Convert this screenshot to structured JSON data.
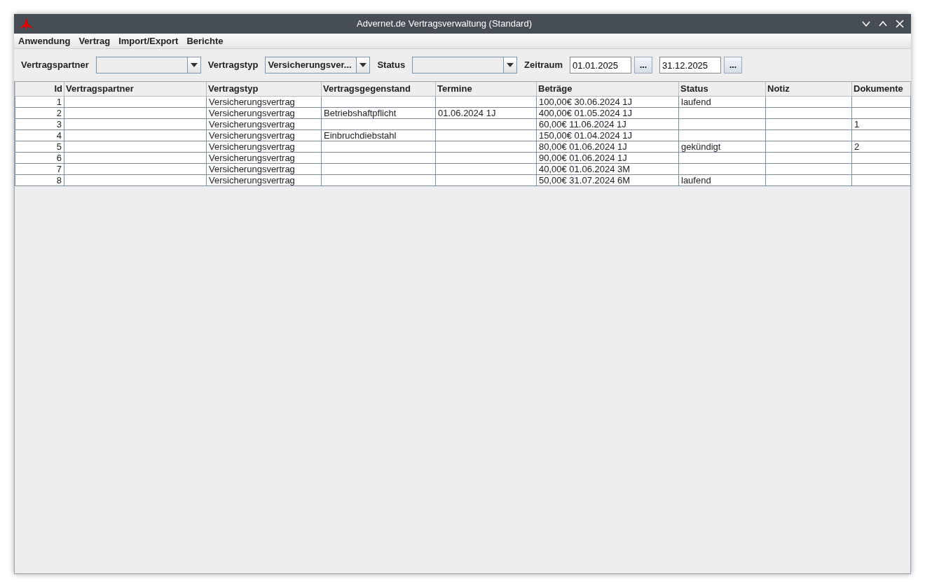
{
  "window": {
    "title": "Advernet.de Vertragsverwaltung (Standard)"
  },
  "menu": [
    "Anwendung",
    "Vertrag",
    "Import/Export",
    "Berichte"
  ],
  "filters": [
    {
      "kind": "combo",
      "label": "Vertragspartner"
    },
    {
      "kind": "combo",
      "label": "Vertragstyp",
      "value": "Versicherungsver..."
    },
    {
      "kind": "combo",
      "label": "Status"
    },
    {
      "kind": "dates",
      "label": "Zeitraum",
      "from": "01.01.2025",
      "to": "31.12.2025",
      "button": "..."
    }
  ],
  "table": {
    "columns": [
      "Id",
      "Vertragspartner",
      "Vertragstyp",
      "Vertragsgegenstand",
      "Termine",
      "Beträge",
      "Status",
      "Notiz",
      "Dokumente"
    ],
    "rows": [
      [
        "1",
        "",
        "Versicherungsvertrag",
        "",
        "",
        "100,00€ 30.06.2024 1J",
        "laufend",
        "",
        ""
      ],
      [
        "2",
        "",
        "Versicherungsvertrag",
        "Betriebshaftpflicht",
        "01.06.2024 1J",
        "400,00€ 01.05.2024 1J",
        "",
        "",
        ""
      ],
      [
        "3",
        "",
        "Versicherungsvertrag",
        "",
        "",
        "60,00€ 11.06.2024 1J",
        "",
        "",
        "1"
      ],
      [
        "4",
        "",
        "Versicherungsvertrag",
        "Einbruchdiebstahl",
        "",
        "150,00€ 01.04.2024 1J",
        "",
        "",
        ""
      ],
      [
        "5",
        "",
        "Versicherungsvertrag",
        "",
        "",
        "80,00€ 01.06.2024 1J",
        "gekündigt",
        "",
        "2"
      ],
      [
        "6",
        "",
        "Versicherungsvertrag",
        "",
        "",
        "90,00€ 01.06.2024 1J",
        "",
        "",
        ""
      ],
      [
        "7",
        "",
        "Versicherungsvertrag",
        "",
        "",
        "40,00€ 01.06.2024 3M",
        "",
        "",
        ""
      ],
      [
        "8",
        "",
        "Versicherungsvertrag",
        "",
        "",
        "50,00€ 31.07.2024 6M",
        "laufend",
        "",
        ""
      ]
    ]
  }
}
